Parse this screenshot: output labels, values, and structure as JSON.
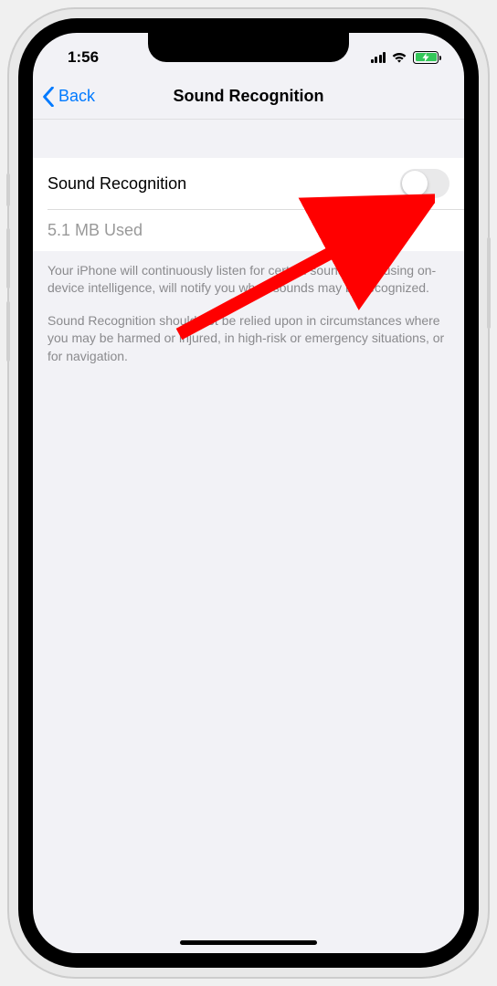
{
  "status": {
    "time": "1:56"
  },
  "nav": {
    "back_label": "Back",
    "title": "Sound Recognition"
  },
  "settings": {
    "toggle_label": "Sound Recognition",
    "toggle_on": false,
    "storage_used": "5.1 MB Used"
  },
  "footer": {
    "p1": "Your iPhone will continuously listen for certain sounds, and using on-device intelligence, will notify you when sounds may be recognized.",
    "p2": "Sound Recognition should not be relied upon in circumstances where you may be harmed or injured, in high-risk or emergency situations, or for navigation."
  }
}
